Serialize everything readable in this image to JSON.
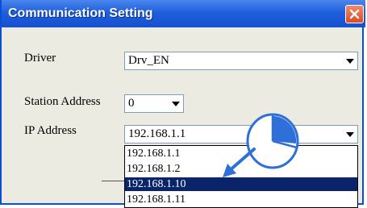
{
  "window": {
    "title": "Communication Setting"
  },
  "form": {
    "driver": {
      "label": "Driver",
      "value": "Drv_EN"
    },
    "station_address": {
      "label": "Station Address",
      "value": "0"
    },
    "ip_address": {
      "label": "IP Address",
      "value": "192.168.1.1",
      "options": [
        "192.168.1.1",
        "192.168.1.2",
        "192.168.1.10",
        "192.168.1.11"
      ],
      "highlighted_option": "192.168.1.10"
    }
  },
  "annotation": {
    "icon": "mouse-click-icon",
    "arrow_color": "#2f6fd8"
  },
  "colors": {
    "titlebar": "#1f5fdc",
    "dialog_bg": "#ecebe1",
    "selection": "#0a246a",
    "close_button": "#d94a25"
  }
}
